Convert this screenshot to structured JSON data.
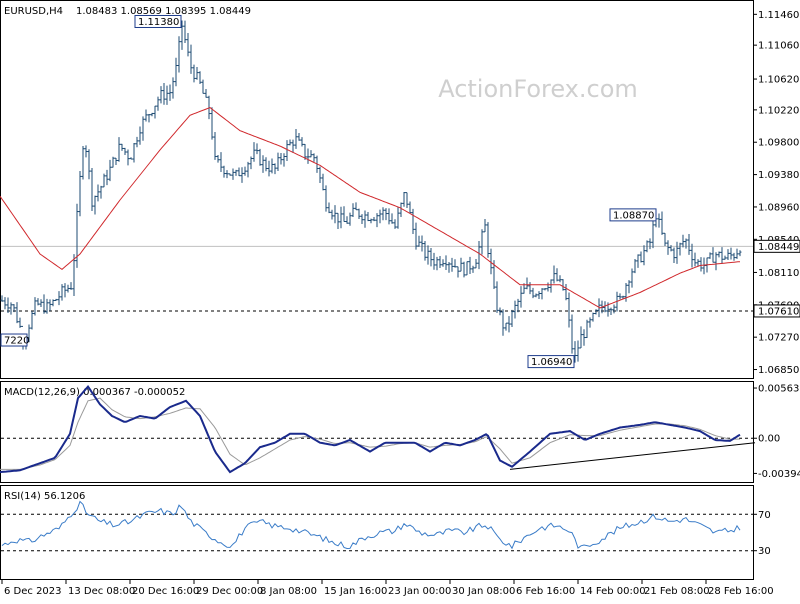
{
  "header": {
    "symbol": "EURUSD,H4",
    "ohlc": "1.08483 1.08569 1.08395 1.08449"
  },
  "watermark": "ActionForex.com",
  "colors": {
    "bar": "#1e4b73",
    "ma": "#d0282c",
    "macd": "#1a2a8c",
    "signal": "#9a9a9a",
    "rsi": "#3a7cc8",
    "label_border": "#1e3c8c"
  },
  "chart_data": [
    {
      "type": "bar",
      "panel": "price",
      "ylim": [
        1.0674,
        1.1162
      ],
      "y_ticks": [
        "1.11460",
        "1.11060",
        "1.10620",
        "1.10220",
        "1.09800",
        "1.09380",
        "1.08960",
        "1.08540",
        "1.08110",
        "1.07690",
        "1.07270",
        "1.06850"
      ],
      "y_tick_values": [
        1.1146,
        1.1106,
        1.1062,
        1.1022,
        1.098,
        1.0938,
        1.0896,
        1.0854,
        1.0811,
        1.0769,
        1.0727,
        1.0685
      ],
      "current_price": {
        "label": "1.08449",
        "value": 1.08449
      },
      "support_line": {
        "label": "1.07610",
        "value": 1.0761
      },
      "annotations": [
        {
          "text": "1.11380",
          "x": 181,
          "value": 1.1138
        },
        {
          "text": "1.08870",
          "x": 656,
          "value": 1.0887
        },
        {
          "text": "1.06940",
          "x": 574,
          "value": 1.0694
        },
        {
          "text": "7220",
          "x": 24,
          "value": 1.0722
        }
      ],
      "anchors_x": [
        0,
        12,
        24,
        36,
        48,
        62,
        72,
        78,
        84,
        92,
        100,
        110,
        120,
        130,
        140,
        150,
        160,
        170,
        178,
        181,
        190,
        200,
        210,
        215,
        225,
        235,
        245,
        255,
        265,
        275,
        285,
        295,
        305,
        315,
        325,
        335,
        345,
        355,
        365,
        375,
        385,
        395,
        405,
        415,
        425,
        435,
        445,
        455,
        465,
        475,
        485,
        495,
        505,
        515,
        525,
        535,
        545,
        555,
        565,
        574,
        580,
        590,
        600,
        610,
        620,
        630,
        640,
        650,
        656,
        665,
        675,
        685,
        695,
        705,
        715,
        725,
        735,
        740
      ],
      "anchors_close": [
        1.0775,
        1.077,
        1.0725,
        1.077,
        1.0765,
        1.0785,
        1.0795,
        1.09,
        1.0995,
        1.0905,
        1.092,
        1.0945,
        1.0975,
        1.096,
        1.1,
        1.102,
        1.104,
        1.1045,
        1.1085,
        1.1138,
        1.108,
        1.1055,
        1.1015,
        1.0955,
        1.0945,
        1.0935,
        1.095,
        1.0965,
        1.095,
        1.0945,
        1.097,
        1.0985,
        1.0965,
        1.096,
        1.0905,
        1.0885,
        1.0875,
        1.089,
        1.0885,
        1.0885,
        1.089,
        1.087,
        1.0915,
        1.0855,
        1.0835,
        1.0825,
        1.083,
        1.082,
        1.0815,
        1.0825,
        1.087,
        1.0775,
        1.0735,
        1.0765,
        1.079,
        1.0785,
        1.0795,
        1.0805,
        1.0785,
        1.0694,
        1.0725,
        1.0745,
        1.0765,
        1.077,
        1.0775,
        1.081,
        1.083,
        1.085,
        1.0887,
        1.0845,
        1.0835,
        1.0855,
        1.0825,
        1.082,
        1.0835,
        1.083,
        1.0835,
        1.0845
      ],
      "ma_anchors_x": [
        0,
        40,
        62,
        80,
        120,
        160,
        190,
        210,
        240,
        280,
        320,
        360,
        400,
        440,
        480,
        520,
        560,
        600,
        640,
        680,
        700,
        740
      ],
      "ma_anchors": [
        1.091,
        1.0835,
        1.0815,
        1.0835,
        1.0905,
        1.097,
        1.1015,
        1.1025,
        1.0995,
        1.0975,
        1.095,
        1.0915,
        1.0895,
        1.0865,
        1.0835,
        1.0795,
        1.0795,
        1.0765,
        1.0785,
        1.081,
        1.082,
        1.0825
      ]
    },
    {
      "type": "line",
      "panel": "macd",
      "title": "MACD(12,26,9) 0.000367 -0.000052",
      "ylim": [
        -0.0048,
        0.0062
      ],
      "y_ticks": [
        "0.005635",
        "0.00",
        "-0.003949"
      ],
      "y_tick_values": [
        0.005635,
        0.0,
        -0.003949
      ],
      "anchors_x": [
        0,
        20,
        40,
        55,
        70,
        78,
        88,
        100,
        112,
        125,
        140,
        155,
        170,
        186,
        200,
        215,
        230,
        245,
        260,
        275,
        290,
        305,
        320,
        335,
        350,
        370,
        385,
        400,
        415,
        430,
        445,
        460,
        475,
        487,
        500,
        512,
        530,
        550,
        570,
        585,
        600,
        620,
        640,
        655,
        670,
        685,
        700,
        715,
        730,
        740
      ],
      "macd": [
        -0.0038,
        -0.0036,
        -0.0028,
        -0.0022,
        0.0005,
        0.0045,
        0.0058,
        0.0038,
        0.0025,
        0.0018,
        0.0025,
        0.0022,
        0.0035,
        0.0042,
        0.0025,
        -0.0015,
        -0.0038,
        -0.0028,
        -0.001,
        -0.0005,
        0.0005,
        0.0005,
        -0.0005,
        -0.0008,
        -0.0002,
        -0.0015,
        -0.0005,
        -0.0005,
        -0.0005,
        -0.0015,
        -0.0005,
        -0.0008,
        -0.0002,
        0.0005,
        -0.0025,
        -0.0032,
        -0.0015,
        0.0005,
        0.0008,
        -0.0002,
        0.0005,
        0.0012,
        0.0015,
        0.0018,
        0.0015,
        0.0012,
        0.0008,
        -0.0002,
        -0.0003,
        0.0004
      ],
      "signal": [
        -0.0035,
        -0.0035,
        -0.003,
        -0.0024,
        -0.0008,
        0.0018,
        0.0042,
        0.0045,
        0.0032,
        0.0024,
        0.0022,
        0.0024,
        0.0028,
        0.0034,
        0.0033,
        0.0012,
        -0.0018,
        -0.003,
        -0.0022,
        -0.0012,
        -0.0002,
        0.0002,
        -0.0001,
        -0.0006,
        -0.0005,
        -0.001,
        -0.0009,
        -0.0006,
        -0.0005,
        -0.001,
        -0.0008,
        -0.0007,
        -0.0004,
        0.0002,
        -0.0012,
        -0.0028,
        -0.0022,
        -0.0005,
        0.0004,
        0.0003,
        0.0003,
        0.0009,
        0.0013,
        0.0016,
        0.0016,
        0.0014,
        0.001,
        0.0003,
        -0.0001,
        -0.0001
      ],
      "trendline": {
        "x": [
          510,
          755
        ],
        "values": [
          -0.0035,
          -0.0005
        ]
      }
    },
    {
      "type": "line",
      "panel": "rsi",
      "title": "RSI(14) 56.1206",
      "ylim": [
        0,
        100
      ],
      "y_ticks": [
        "70",
        "30"
      ],
      "y_tick_values": [
        70,
        30
      ],
      "anchors_x": [
        0,
        15,
        30,
        45,
        60,
        72,
        80,
        88,
        100,
        115,
        130,
        145,
        160,
        172,
        181,
        190,
        205,
        220,
        232,
        245,
        260,
        275,
        290,
        305,
        320,
        335,
        350,
        365,
        380,
        395,
        405,
        420,
        435,
        450,
        465,
        480,
        487,
        500,
        512,
        525,
        540,
        555,
        570,
        580,
        600,
        620,
        640,
        655,
        670,
        685,
        700,
        715,
        730,
        740
      ],
      "values": [
        35,
        42,
        40,
        48,
        55,
        72,
        82,
        70,
        62,
        58,
        62,
        70,
        74,
        70,
        80,
        63,
        50,
        40,
        35,
        55,
        62,
        57,
        55,
        50,
        45,
        38,
        35,
        45,
        50,
        52,
        60,
        50,
        47,
        52,
        50,
        57,
        58,
        42,
        35,
        45,
        55,
        58,
        52,
        32,
        42,
        55,
        62,
        68,
        62,
        65,
        58,
        50,
        52,
        56
      ]
    }
  ],
  "x_axis": {
    "labels": [
      "6 Dec 2023",
      "13 Dec 08:00",
      "20 Dec 16:00",
      "29 Dec 00:00",
      "8 Jan 08:00",
      "15 Jan 16:00",
      "23 Jan 00:00",
      "30 Jan 08:00",
      "6 Feb 16:00",
      "14 Feb 00:00",
      "21 Feb 08:00",
      "28 Feb 16:00"
    ],
    "positions": [
      2,
      66,
      130,
      194,
      258,
      322,
      386,
      450,
      514,
      578,
      642,
      706
    ]
  }
}
